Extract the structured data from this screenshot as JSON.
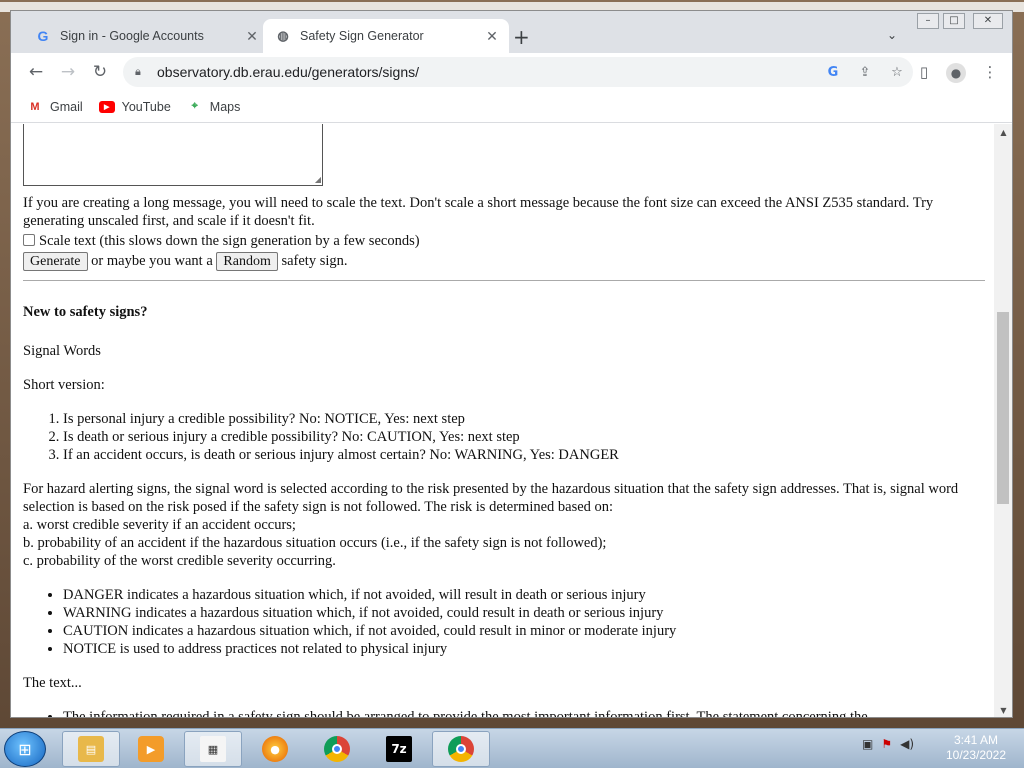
{
  "browser": {
    "tabs": [
      {
        "label": "Sign in - Google Accounts",
        "icon": "google-icon",
        "active": false
      },
      {
        "label": "Safety Sign Generator",
        "icon": "globe-icon",
        "active": true
      }
    ],
    "url": "observatory.db.erau.edu/generators/signs/",
    "bookmarks": [
      {
        "label": "Gmail",
        "icon": "gmail-icon"
      },
      {
        "label": "YouTube",
        "icon": "youtube-icon"
      },
      {
        "label": "Maps",
        "icon": "maps-icon"
      }
    ]
  },
  "page": {
    "scale_note": "If you are creating a long message, you will need to scale the text. Don't scale a short message because the font size can exceed the ANSI Z535 standard. Try generating unscaled first, and scale if it doesn't fit.",
    "scale_checkbox_label": "Scale text (this slows down the sign generation by a few seconds)",
    "generate_button": "Generate",
    "or_text": "or maybe you want a",
    "random_button": "Random",
    "safety_sign_text": "safety sign.",
    "heading": "New to safety signs?",
    "signal_words": "Signal Words",
    "short_version": "Short version:",
    "steps": [
      "Is personal injury a credible possibility? No: NOTICE, Yes: next step",
      "Is death or serious injury a credible possibility? No: CAUTION, Yes: next step",
      "If an accident occurs, is death or serious injury almost certain? No: WARNING, Yes: DANGER"
    ],
    "hazard_para": "For hazard alerting signs, the signal word is selected according to the risk presented by the hazardous situation that the safety sign addresses. That is, signal word selection is based on the risk posed if the safety sign is not followed. The risk is determined based on:",
    "hazard_a": "a. worst credible severity if an accident occurs;",
    "hazard_b": "b. probability of an accident if the hazardous situation occurs (i.e., if the safety sign is not followed);",
    "hazard_c": "c. probability of the worst credible severity occurring.",
    "definitions": [
      "DANGER indicates a hazardous situation which, if not avoided, will result in death or serious injury",
      "WARNING indicates a hazardous situation which, if not avoided, could result in death or serious injury",
      "CAUTION indicates a hazardous situation which, if not avoided, could result in minor or moderate injury",
      "NOTICE is used to address practices not related to physical injury"
    ],
    "the_text": "The text...",
    "text_bullet": "The information required in a safety sign should be arranged to provide the most important information first. The statement concerning the"
  },
  "taskbar": {
    "items": [
      "explorer-icon",
      "media-player-icon",
      "document-icon",
      "firefox-icon",
      "chrome-icon",
      "7zip-icon",
      "chrome-profile-icon"
    ],
    "time": "3:41 AM",
    "date": "10/23/2022"
  }
}
